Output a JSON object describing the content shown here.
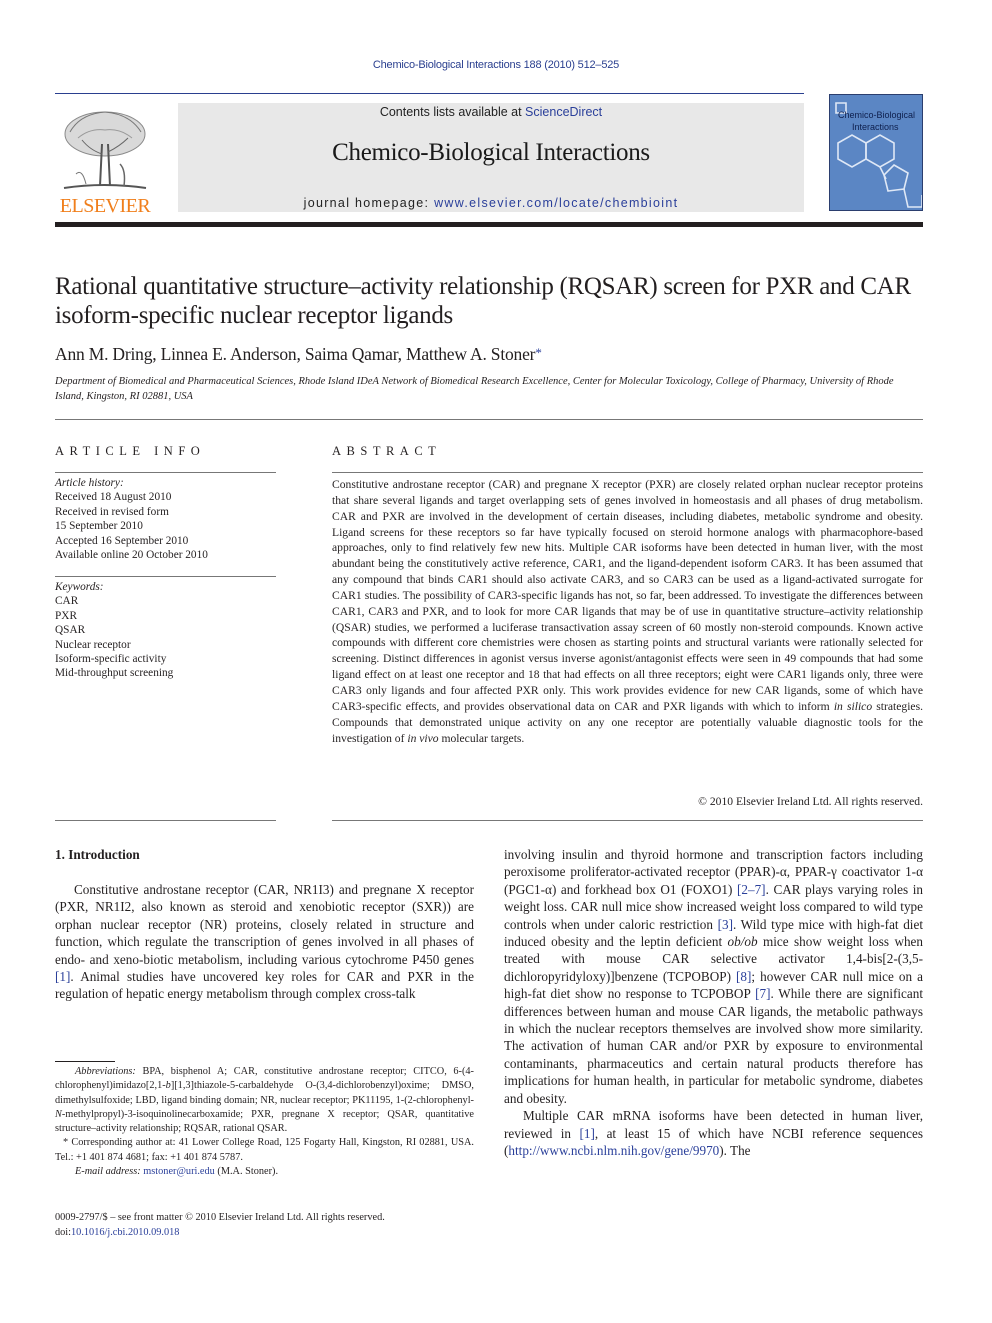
{
  "running_head": "Chemico-Biological Interactions 188 (2010) 512–525",
  "masthead": {
    "contents_prefix": "Contents lists available at ",
    "contents_link": "ScienceDirect",
    "journal_title": "Chemico-Biological Interactions",
    "homepage_prefix": "journal homepage: ",
    "homepage_link": "www.elsevier.com/locate/chembioint",
    "publisher_logo_text": "ELSEVIER",
    "cover_title_line1": "Chemico-Biological",
    "cover_title_line2": "Interactions",
    "colors": {
      "publisher_orange": "#f07f1c",
      "link_blue": "#2a3f9a",
      "masthead_gray": "#e8e8e8",
      "cover_blue": "#5b86c4"
    }
  },
  "article": {
    "title": "Rational quantitative structure–activity relationship (RQSAR) screen for PXR and CAR isoform-specific nuclear receptor ligands",
    "authors": "Ann M. Dring, Linnea E. Anderson, Saima Qamar, Matthew A. Stoner",
    "corresponding_mark": "*",
    "affiliation": "Department of Biomedical and Pharmaceutical Sciences, Rhode Island IDeA Network of Biomedical Research Excellence, Center for Molecular Toxicology, College of Pharmacy, University of Rhode Island, Kingston, RI 02881, USA"
  },
  "article_info": {
    "heading": "ARTICLE INFO",
    "history_label": "Article history:",
    "history": [
      "Received 18 August 2010",
      "Received in revised form",
      "15 September 2010",
      "Accepted 16 September 2010",
      "Available online 20 October 2010"
    ],
    "keywords_label": "Keywords:",
    "keywords": [
      "CAR",
      "PXR",
      "QSAR",
      "Nuclear receptor",
      "Isoform-specific activity",
      "Mid-throughput screening"
    ]
  },
  "abstract": {
    "heading": "ABSTRACT",
    "part1": "Constitutive androstane receptor (CAR) and pregnane X receptor (PXR) are closely related orphan nuclear receptor proteins that share several ligands and target overlapping sets of genes involved in homeostasis and all phases of drug metabolism. CAR and PXR are involved in the development of certain diseases, including diabetes, metabolic syndrome and obesity. Ligand screens for these receptors so far have typically focused on steroid hormone analogs with pharmacophore-based approaches, only to find relatively few new hits. Multiple CAR isoforms have been detected in human liver, with the most abundant being the constitutively active reference, CAR1, and the ligand-dependent isoform CAR3. It has been assumed that any compound that binds CAR1 should also activate CAR3, and so CAR3 can be used as a ligand-activated surrogate for CAR1 studies. The possibility of CAR3-specific ligands has not, so far, been addressed. To investigate the differences between CAR1, CAR3 and PXR, and to look for more CAR ligands that may be of use in quantitative structure–activity relationship (QSAR) studies, we performed a luciferase transactivation assay screen of 60 mostly non-steroid compounds. Known active compounds with different core chemistries were chosen as starting points and structural variants were rationally selected for screening. Distinct differences in agonist versus inverse agonist/antagonist effects were seen in 49 compounds that had some ligand effect on at least one receptor and 18 that had effects on all three receptors; eight were CAR1 ligands only, three were CAR3 only ligands and four affected PXR only. This work provides evidence for new CAR ligands, some of which have CAR3-specific effects, and provides observational data on CAR and PXR ligands with which to inform ",
    "italic1": "in silico",
    "part2": " strategies. Compounds that demonstrated unique activity on any one receptor are potentially valuable diagnostic tools for the investigation of ",
    "italic2": "in vivo",
    "part3": " molecular targets.",
    "copyright": "© 2010 Elsevier Ireland Ltd. All rights reserved."
  },
  "introduction": {
    "heading": "1.  Introduction",
    "col1_p1_a": "Constitutive androstane receptor (CAR, NR1I3) and pregnane X receptor (PXR, NR1I2, also known as steroid and xenobiotic receptor (SXR)) are orphan nuclear receptor (NR) proteins, closely related in structure and function, which regulate the transcription of genes involved in all phases of endo- and xeno-biotic metabolism, including various cytochrome P450 genes ",
    "ref1": "[1]",
    "col1_p1_b": ". Animal studies have uncovered key roles for CAR and PXR in the regulation of hepatic energy metabolism through complex cross-talk",
    "col2_a": "involving insulin and thyroid hormone and transcription factors including peroxisome proliferator-activated receptor (PPAR)-α, PPAR-γ coactivator 1-α (PGC1-α) and forkhead box O1 (FOXO1) ",
    "ref_2_7": "[2–7]",
    "col2_b": ". CAR plays varying roles in weight loss. CAR null mice show increased weight loss compared to wild type controls when under caloric restriction ",
    "ref3": "[3]",
    "col2_c": ". Wild type mice with high-fat diet induced obesity and the leptin deficient ",
    "italic_obob": "ob/ob",
    "col2_d": " mice show weight loss when treated with mouse CAR selective activator 1,4-bis[2-(3,5-dichloropyridyloxy)]benzene (TCPOBOP) ",
    "ref8": "[8]",
    "col2_e": "; however CAR null mice on a high-fat diet show no response to TCPOBOP ",
    "ref7": "[7]",
    "col2_f": ". While there are significant differences between human and mouse CAR ligands, the metabolic pathways in which the nuclear receptors themselves are involved show more similarity. The activation of human CAR and/or PXR by exposure to environmental contaminants, pharmaceutics and certain natural products therefore has implications for human health, in particular for metabolic syndrome, diabetes and obesity.",
    "col2_p2_a": "Multiple CAR mRNA isoforms have been detected in human liver, reviewed in ",
    "ref1b": "[1]",
    "col2_p2_b": ", at least 15 of which have NCBI reference sequences (",
    "ncbi_link": "http://www.ncbi.nlm.nih.gov/gene/9970",
    "col2_p2_c": "). The"
  },
  "footnotes": {
    "abbrev_label": "Abbreviations:",
    "abbrev_text_a": "   BPA, bisphenol A; CAR, constitutive androstane receptor; CITCO, 6-(4-chlorophenyl)imidazo[2,1-",
    "abbrev_italic_b": "b",
    "abbrev_text_b": "][1,3]thiazole-5-carbaldehyde O-(3,4-dichlorobenzyl)oxime; DMSO, dimethylsulfoxide; LBD, ligand binding domain; NR, nuclear receptor; PK11195, 1-(2-chlorophenyl-",
    "abbrev_italic_n": "N",
    "abbrev_text_c": "-methylpropyl)-3-isoquinolinecarboxamide; PXR, pregnane X receptor; QSAR, quantitative structure–activity relationship; RQSAR, rational QSAR.",
    "corresponding": "* Corresponding author at: 41 Lower College Road, 125 Fogarty Hall, Kingston, RI 02881, USA. Tel.: +1 401 874 4681; fax: +1 401 874 5787.",
    "email_label": "E-mail address:",
    "email": "mstoner@uri.edu",
    "email_suffix": " (M.A. Stoner)."
  },
  "front_matter": {
    "issn_line": "0009-2797/$ – see front matter © 2010 Elsevier Ireland Ltd. All rights reserved.",
    "doi_prefix": "doi:",
    "doi": "10.1016/j.cbi.2010.09.018"
  }
}
